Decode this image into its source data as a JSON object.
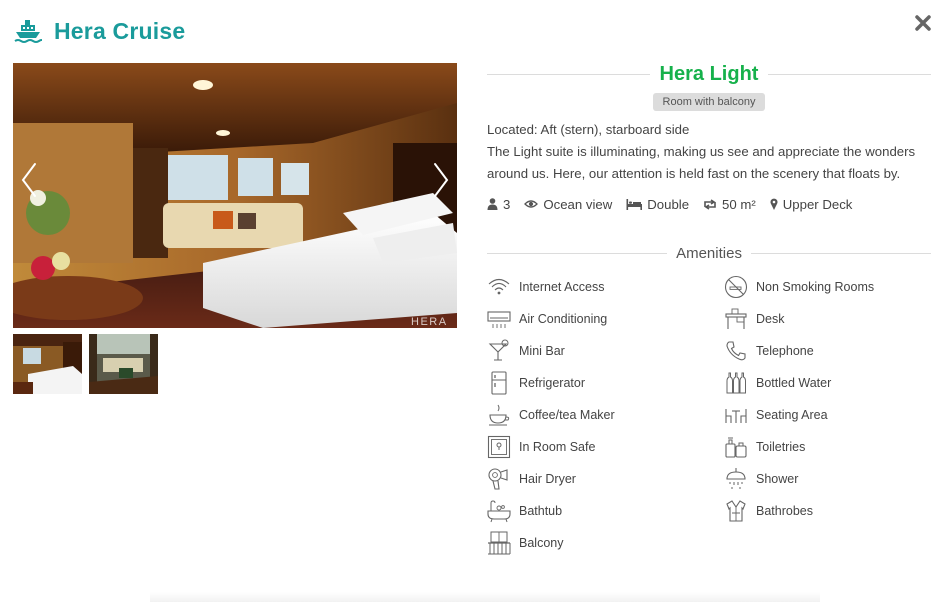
{
  "brand": {
    "title": "Hera Cruise",
    "icon": "ship-icon",
    "color": "#1a9b9b"
  },
  "close": {
    "icon": "close-icon"
  },
  "gallery": {
    "prev_icon": "chevron-left-icon",
    "next_icon": "chevron-right-icon",
    "watermark": "HERA",
    "thumbnails": [
      "thumbnail-1",
      "thumbnail-2"
    ]
  },
  "room": {
    "title": "Hera Light",
    "title_color": "#16b14b",
    "badge": "Room with balcony",
    "located": "Located: Aft (stern), starboard side",
    "description": "The Light suite is illuminating, making us see and appreciate the wonders around us. Here, our attention is held fast on the scenery that floats by."
  },
  "specs": [
    {
      "icon": "user-icon",
      "label": "3"
    },
    {
      "icon": "eye-icon",
      "label": "Ocean view"
    },
    {
      "icon": "bed-icon",
      "label": "Double"
    },
    {
      "icon": "resize-icon",
      "label": "50 m²"
    },
    {
      "icon": "map-marker-icon",
      "label": "Upper Deck"
    }
  ],
  "amenities": {
    "title": "Amenities",
    "items": [
      {
        "icon": "wifi-icon",
        "label": "Internet Access"
      },
      {
        "icon": "no-smoking-icon",
        "label": "Non Smoking Rooms"
      },
      {
        "icon": "air-conditioner-icon",
        "label": "Air Conditioning"
      },
      {
        "icon": "desk-icon",
        "label": "Desk"
      },
      {
        "icon": "cocktail-icon",
        "label": "Mini Bar"
      },
      {
        "icon": "telephone-icon",
        "label": "Telephone"
      },
      {
        "icon": "fridge-icon",
        "label": "Refrigerator"
      },
      {
        "icon": "bottles-icon",
        "label": "Bottled Water"
      },
      {
        "icon": "coffee-maker-icon",
        "label": "Coffee/tea Maker"
      },
      {
        "icon": "seating-icon",
        "label": "Seating Area"
      },
      {
        "icon": "safe-icon",
        "label": "In Room Safe"
      },
      {
        "icon": "toiletries-icon",
        "label": "Toiletries"
      },
      {
        "icon": "hair-dryer-icon",
        "label": "Hair Dryer"
      },
      {
        "icon": "shower-icon",
        "label": "Shower"
      },
      {
        "icon": "bathtub-icon",
        "label": "Bathtub"
      },
      {
        "icon": "bathrobe-icon",
        "label": "Bathrobes"
      },
      {
        "icon": "balcony-icon",
        "label": "Balcony"
      }
    ]
  }
}
